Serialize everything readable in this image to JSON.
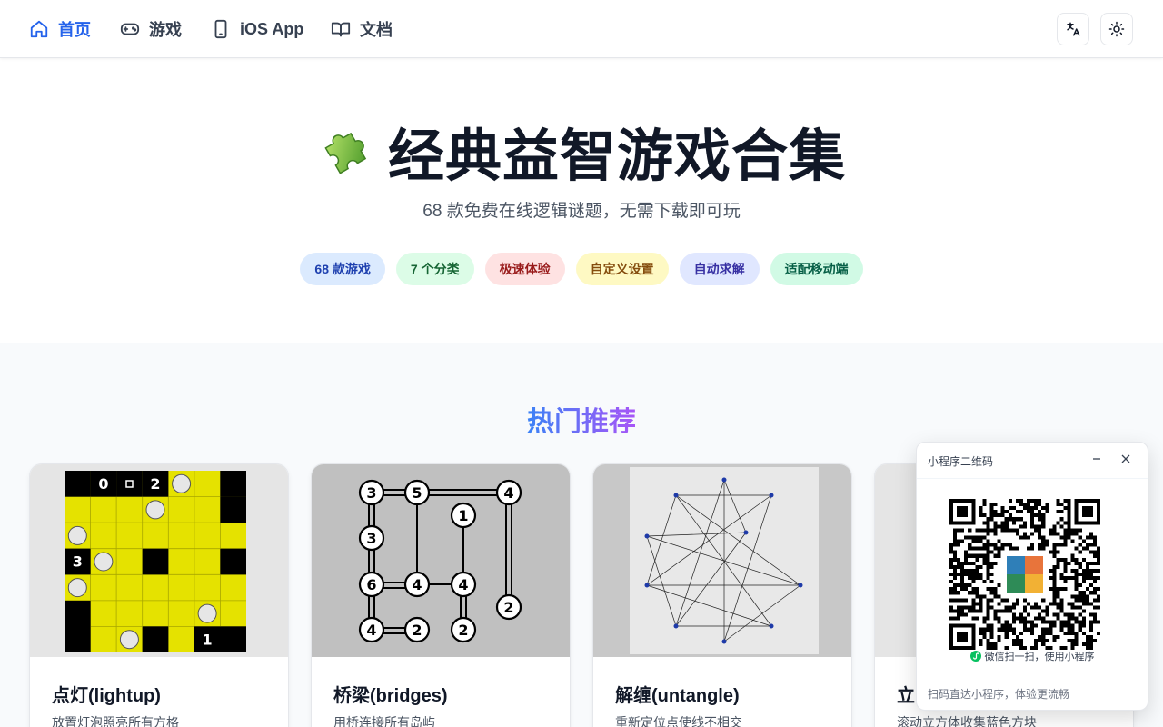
{
  "nav": {
    "items": [
      {
        "label": "首页",
        "icon": "home-icon",
        "active": true
      },
      {
        "label": "游戏",
        "icon": "gamepad-icon"
      },
      {
        "label": "iOS App",
        "icon": "phone-icon"
      },
      {
        "label": "文档",
        "icon": "book-icon"
      }
    ],
    "buttons": [
      "translate-icon",
      "sun-icon"
    ]
  },
  "hero": {
    "title": "经典益智游戏合集",
    "subtitle": "68 款免费在线逻辑谜题，无需下载即可玩",
    "tags": [
      {
        "label": "68 款游戏",
        "bg": "#dbeafe",
        "fg": "#1e40af"
      },
      {
        "label": "7 个分类",
        "bg": "#dcfce7",
        "fg": "#166534"
      },
      {
        "label": "极速体验",
        "bg": "#fee2e2",
        "fg": "#991b1b"
      },
      {
        "label": "自定义设置",
        "bg": "#fef9c3",
        "fg": "#854d0e"
      },
      {
        "label": "自动求解",
        "bg": "#e0e7ff",
        "fg": "#3730a3"
      },
      {
        "label": "适配移动端",
        "bg": "#d1fae5",
        "fg": "#065f46"
      }
    ]
  },
  "section": {
    "title": "热门推荐",
    "cards": [
      {
        "title": "点灯(lightup)",
        "desc": "放置灯泡照亮所有方格"
      },
      {
        "title": "桥梁(bridges)",
        "desc": "用桥连接所有岛屿"
      },
      {
        "title": "解缠(untangle)",
        "desc": "重新定位点使线不相交"
      },
      {
        "title": "立",
        "desc": "滚动立方体收集蓝色方块"
      }
    ]
  },
  "lightup": {
    "numbers": [
      "0",
      "2",
      "3",
      "1"
    ]
  },
  "bridges": {
    "islands": [
      "3",
      "5",
      "4",
      "1",
      "3",
      "6",
      "4",
      "4",
      "2",
      "4",
      "2",
      "2"
    ]
  },
  "qr": {
    "title": "小程序二维码",
    "caption": "微信扫一扫，使用小程序",
    "footer": "扫码直达小程序，体验更流畅"
  },
  "colors": {
    "accent": "#2563eb",
    "lightup_yellow": "#e5e200",
    "wechat_green": "#07c160"
  }
}
